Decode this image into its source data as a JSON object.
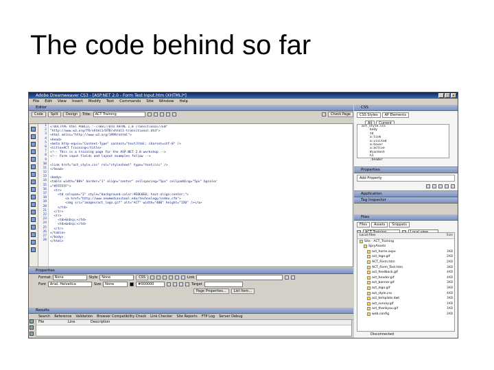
{
  "slide": {
    "title": "The code behind so far"
  },
  "window": {
    "title": "Adobe Dreamweaver CS3 - [ASP.NET 2.0 - Form Test Input.htm (XHTML)*]",
    "controls": [
      "_",
      "□",
      "×"
    ]
  },
  "menu": [
    "File",
    "Edit",
    "View",
    "Insert",
    "Modify",
    "Text",
    "Commands",
    "Site",
    "Window",
    "Help"
  ],
  "document": {
    "panel_title": "Editor",
    "tabs": [
      "Code",
      "Split",
      "Design"
    ],
    "title_label": "Title:",
    "title_value": "ACT Training",
    "check_page_label": "Check Page"
  },
  "code_lines": [
    "<!DOCTYPE html PUBLIC \"-//W3C//DTD XHTML 1.0 Transitional//EN\"",
    "\"http://www.w3.org/TR/xhtml1/DTD/xhtml1-transitional.dtd\">",
    "<html xmlns=\"http://www.w3.org/1999/xhtml\">",
    "<head>",
    "<meta http-equiv=\"Content-Type\" content=\"text/html; charset=utf-8\" />",
    "<title>ACT Training</title>",
    "<!-- This is a training page for the ASP.NET 2.0 workshop -->",
    "<!-- Form input fields and layout examples follow -->",
    "",
    "<link href=\"act_style.css\" rel=\"stylesheet\" type=\"text/css\" />",
    "</head>",
    "",
    "<body>",
    "<table width=\"80%\" border=\"1\" align=\"center\" cellspacing=\"5px\" cellpadding=\"5px\" bgcolor",
    "=\"#FFFFFF\">",
    "  <tr>",
    "    <td colspan=\"2\" style=\"background-color:#E0E0E0; text-align:center;\">",
    "        <a href=\"http://www.newmediaschool.edu/technology/index.cfm\">",
    "        <img src=\"images/act_logo.gif\" alt=\"ACT\" width=\"400\" height=\"150\" /></a>",
    "    </td>",
    "  </tr>",
    "  <tr>",
    "    <td>&nbsp;</td>",
    "    <td>&nbsp;</td>",
    "  </tr>",
    "</table>",
    "</body>",
    "</html>"
  ],
  "properties": {
    "panel_title": "Properties",
    "format_label": "Format",
    "format_value": "None",
    "style_label": "Style",
    "style_value": "None",
    "css_button": "CSS",
    "font_label": "Font",
    "font_value": "Arial, Helvetica",
    "size_label": "Size",
    "size_value": "None",
    "color_value": "#000000",
    "link_label": "Link",
    "target_label": "Target",
    "page_properties_button": "Page Properties...",
    "list_item_button": "List Item..."
  },
  "results": {
    "panel_title": "Results",
    "tabs": [
      "Search",
      "Reference",
      "Validation",
      "Browser Compatibility Check",
      "Link Checker",
      "Site Reports",
      "FTP Log",
      "Server Debug"
    ],
    "columns": [
      "File",
      "Line",
      "Description"
    ]
  },
  "css_panel": {
    "panel_title": "CSS",
    "tabs": [
      "CSS Styles",
      "AP Elements"
    ],
    "mode_tabs": [
      "All",
      "Current"
    ],
    "all_rules_label": "All Rules",
    "rules": [
      "act_style.css",
      "body",
      "td",
      "a:link",
      "a:visited",
      "a:hover",
      "a:active",
      "#content",
      "h1",
      ".header"
    ]
  },
  "rule_props": {
    "panel_title": "Properties",
    "add_property": "Add Property"
  },
  "side_panels": [
    "Application",
    "Tag Inspector"
  ],
  "files_panel": {
    "panel_title": "Files",
    "tabs": [
      "Files",
      "Assets",
      "Snippets"
    ],
    "site_value": "ACT Training",
    "view_value": "Local view",
    "columns": [
      "Local Files",
      "Size"
    ],
    "items": [
      {
        "name": "Site - ACT_Training",
        "size": ""
      },
      {
        "name": "SpryAssets",
        "size": ""
      },
      {
        "name": "act_home.aspx",
        "size": "3KB"
      },
      {
        "name": "act_logo.gif",
        "size": "2KB"
      },
      {
        "name": "ACT_Form.htm",
        "size": "2KB"
      },
      {
        "name": "ACT_Form_Test.htm",
        "size": "3KB"
      },
      {
        "name": "act_feedback.gif",
        "size": "4KB"
      },
      {
        "name": "act_header.gif",
        "size": "4KB"
      },
      {
        "name": "act_banner.gif",
        "size": "3KB"
      },
      {
        "name": "act_logo.gif",
        "size": "3KB"
      },
      {
        "name": "act_style.css",
        "size": "4KB"
      },
      {
        "name": "act_template.dwt",
        "size": "3KB"
      },
      {
        "name": "act_survey.gif",
        "size": "1KB"
      },
      {
        "name": "act_thankyou.gif",
        "size": "1KB"
      },
      {
        "name": "web.config",
        "size": "2KB"
      }
    ],
    "status": "Disconnected"
  }
}
